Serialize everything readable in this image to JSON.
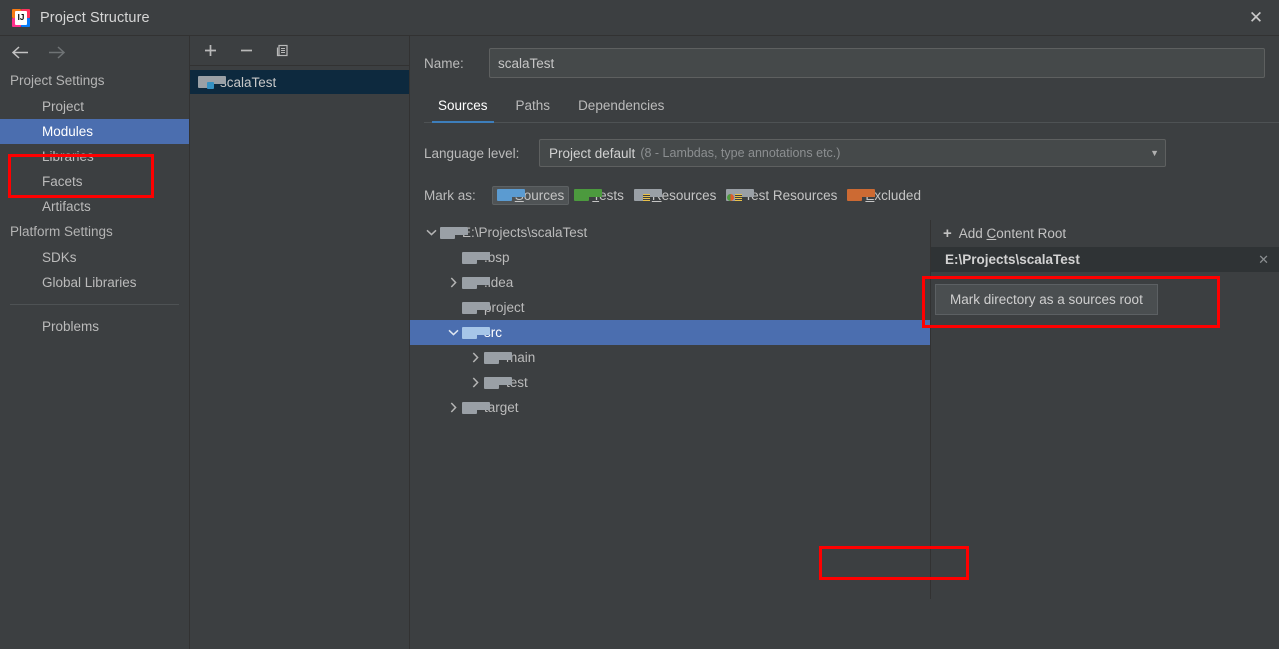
{
  "window": {
    "title": "Project Structure",
    "app_icon": "intellij-idea-icon",
    "close_icon": "close-icon"
  },
  "sidebar": {
    "back_icon": "back-arrow-icon",
    "forward_icon": "forward-arrow-icon",
    "groups": [
      {
        "title": "Project Settings",
        "items": [
          {
            "label": "Project",
            "selected": false
          },
          {
            "label": "Modules",
            "selected": true
          },
          {
            "label": "Libraries",
            "selected": false
          },
          {
            "label": "Facets",
            "selected": false
          },
          {
            "label": "Artifacts",
            "selected": false
          }
        ]
      },
      {
        "title": "Platform Settings",
        "items": [
          {
            "label": "SDKs",
            "selected": false
          },
          {
            "label": "Global Libraries",
            "selected": false
          }
        ]
      }
    ],
    "problems_label": "Problems"
  },
  "modules_panel": {
    "toolbar": [
      {
        "name": "add-module-button",
        "glyph": "+"
      },
      {
        "name": "remove-module-button",
        "glyph": "−"
      },
      {
        "name": "copy-module-button",
        "glyph": "copy-icon"
      }
    ],
    "items": [
      {
        "label": "scalaTest",
        "icon": "module-folder-icon",
        "selected": true
      }
    ]
  },
  "detail": {
    "name_label": "Name:",
    "name_value": "scalaTest",
    "name_placeholder": "",
    "tabs": [
      {
        "label": "Sources",
        "active": true
      },
      {
        "label": "Paths",
        "active": false
      },
      {
        "label": "Dependencies",
        "active": false
      }
    ],
    "language_level": {
      "label": "Language level:",
      "value": "Project default",
      "hint": "(8 - Lambdas, type annotations etc.)",
      "arrow_icon": "chevron-down-icon"
    },
    "mark_as": {
      "label": "Mark as:",
      "buttons": [
        {
          "label": "Sources",
          "mnemonic": "S",
          "rest": "ources",
          "color": "#3592c4",
          "pressed": true,
          "icon": "sources-folder-icon"
        },
        {
          "label": "Tests",
          "mnemonic": "T",
          "rest": "ests",
          "color": "#4c9a3e",
          "pressed": false,
          "icon": "tests-folder-icon"
        },
        {
          "label": "Resources",
          "mnemonic": "R",
          "rest": "esources",
          "color": "#9aa0a6",
          "pressed": false,
          "icon": "resources-folder-icon"
        },
        {
          "label": "Test Resources",
          "mnemonic": "",
          "rest": "Test Resources",
          "color": "#9aa0a6",
          "pressed": false,
          "icon": "test-resources-folder-icon"
        },
        {
          "label": "Excluded",
          "mnemonic": "E",
          "rest": "xcluded",
          "color": "#cc6a33",
          "pressed": false,
          "icon": "excluded-folder-icon"
        }
      ]
    },
    "tree": [
      {
        "label": "E:\\Projects\\scalaTest",
        "depth": 0,
        "twisty": "expanded",
        "icon": "folder-grey-icon",
        "selected": false
      },
      {
        "label": ".bsp",
        "depth": 1,
        "twisty": "none",
        "icon": "folder-grey-icon",
        "selected": false
      },
      {
        "label": ".idea",
        "depth": 1,
        "twisty": "collapsed",
        "icon": "folder-grey-icon",
        "selected": false
      },
      {
        "label": "project",
        "depth": 1,
        "twisty": "none",
        "icon": "folder-grey-icon",
        "selected": false
      },
      {
        "label": "src",
        "depth": 1,
        "twisty": "expanded",
        "icon": "folder-lightblue-icon",
        "selected": true
      },
      {
        "label": "main",
        "depth": 2,
        "twisty": "collapsed",
        "icon": "folder-grey-icon",
        "selected": false
      },
      {
        "label": "test",
        "depth": 2,
        "twisty": "collapsed",
        "icon": "folder-grey-icon",
        "selected": false
      },
      {
        "label": "target",
        "depth": 1,
        "twisty": "collapsed",
        "icon": "folder-grey-icon",
        "selected": false
      }
    ],
    "content_roots": {
      "add_label_prefix": "Add ",
      "add_mnemonic": "C",
      "add_label_suffix": "ontent Root",
      "add_icon": "plus-icon",
      "rows": [
        {
          "path": "E:\\Projects\\scalaTest",
          "remove_icon": "close-icon"
        }
      ]
    }
  },
  "tooltip": {
    "text": "Mark directory as a sources root"
  },
  "annotations": {
    "color": "#fe0000",
    "boxes": [
      "modules-nav-item",
      "tooltip-region",
      "src-tree-row"
    ]
  },
  "colors": {
    "background": "#3c3f41",
    "selection_blue": "#4b6eaf",
    "selection_navy": "#0d293e",
    "accent": "#3d7ebb",
    "annotation_red": "#fe0000"
  }
}
